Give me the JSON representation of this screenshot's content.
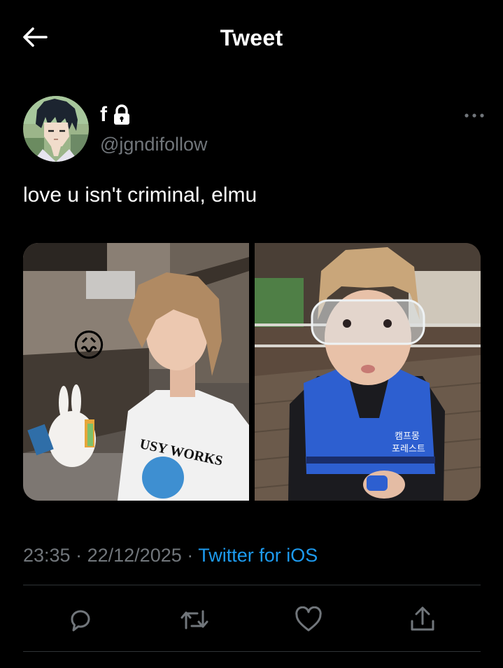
{
  "header": {
    "title": "Tweet",
    "back_icon": "arrow-left-icon"
  },
  "author": {
    "display_name": "f",
    "protected_icon": "lock-icon",
    "handle": "@jgndifollow",
    "more_icon": "more-horizontal-icon"
  },
  "tweet": {
    "text": "love u isn't criminal, elmu",
    "photos": [
      {
        "alt": "photo-1",
        "emoji": "😖",
        "shirt_text": "USY WORKS"
      },
      {
        "alt": "photo-2",
        "vest_text_1": "캠프몽",
        "vest_text_2": "포레스트"
      }
    ],
    "time": "23:35",
    "separator": "·",
    "date": "22/12/2025",
    "source": "Twitter for iOS"
  },
  "actions": [
    {
      "name": "reply",
      "icon": "reply-icon"
    },
    {
      "name": "retweet",
      "icon": "retweet-icon"
    },
    {
      "name": "like",
      "icon": "heart-icon"
    },
    {
      "name": "share",
      "icon": "share-icon"
    }
  ],
  "colors": {
    "background": "#000000",
    "text": "#e7e9ea",
    "muted": "#71767b",
    "link": "#1d9bf0",
    "divider": "#2f3336"
  }
}
